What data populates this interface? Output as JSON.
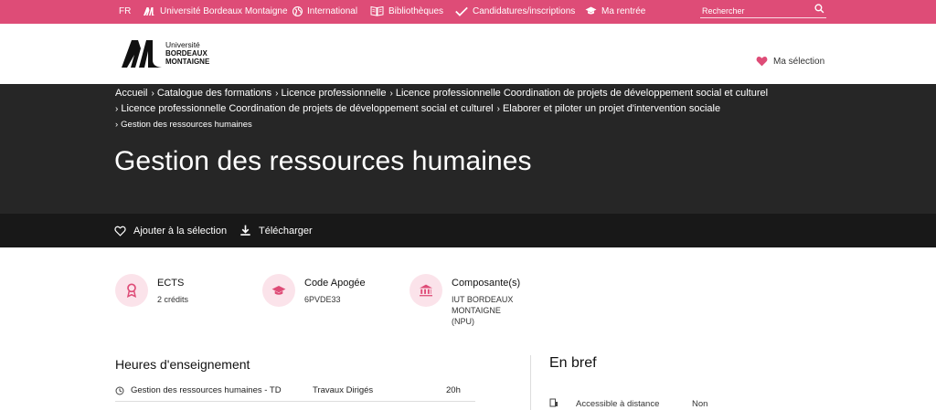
{
  "topbar": {
    "lang": "FR",
    "university": "Université Bordeaux Montaigne",
    "international": "International",
    "libraries": "Bibliothèques",
    "applications": "Candidatures/inscriptions",
    "back_to_school": "Ma rentrée",
    "search_placeholder": "Rechercher"
  },
  "header": {
    "logo_line1": "Université",
    "logo_line2": "BORDEAUX",
    "logo_line3": "MONTAIGNE",
    "selection": "Ma sélection"
  },
  "breadcrumb": [
    "Accueil",
    "Catalogue des formations",
    "Licence professionnelle",
    "Licence professionnelle Coordination de projets de développement social et culturel",
    "Licence professionnelle Coordination de projets de développement social et culturel",
    "Elaborer et piloter un projet d'intervention sociale",
    "Gestion des ressources humaines"
  ],
  "page_title": "Gestion des ressources humaines",
  "actions": {
    "add": "Ajouter à la sélection",
    "download": "Télécharger"
  },
  "info": {
    "ects_title": "ECTS",
    "ects_value": "2 crédits",
    "code_title": "Code Apogée",
    "code_value": "6PVDE33",
    "comp_title": "Composante(s)",
    "comp_value_1": "IUT BORDEAUX",
    "comp_value_2": "MONTAIGNE",
    "comp_value_3": "(NPU)"
  },
  "hours": {
    "heading": "Heures d'enseignement",
    "row_name": "Gestion des ressources humaines - TD",
    "row_type": "Travaux Dirigés",
    "row_hours": "20h"
  },
  "brief": {
    "heading": "En bref",
    "item_label": "Accessible à distance",
    "item_value": "Non"
  },
  "colors": {
    "accent": "#de4c77",
    "banner": "#262626"
  }
}
